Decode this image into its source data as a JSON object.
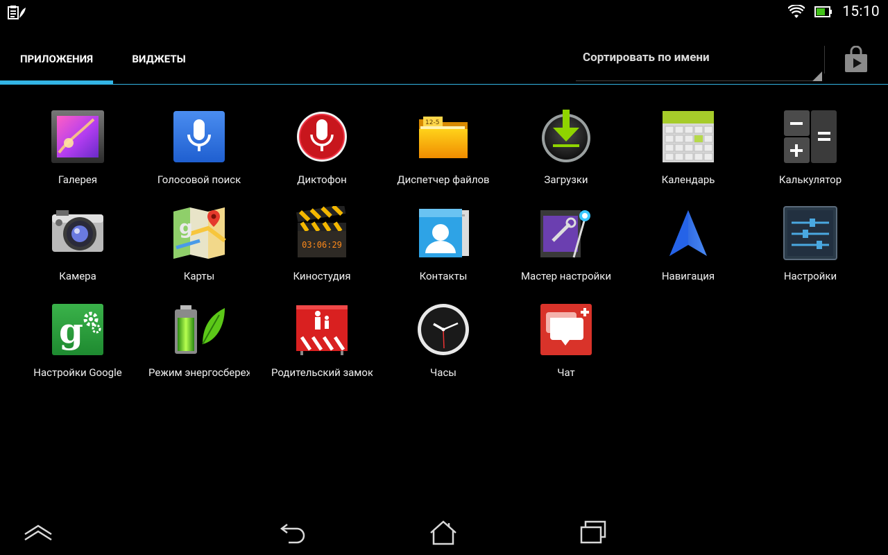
{
  "status_bar": {
    "time": "15:10",
    "left_icons": [
      "notification-clipboard-icon"
    ],
    "right_icons": [
      "wifi-icon",
      "battery-icon"
    ]
  },
  "tabs": [
    {
      "label": "ПРИЛОЖЕНИЯ",
      "selected": true
    },
    {
      "label": "ВИДЖЕТЫ",
      "selected": false
    }
  ],
  "sort": {
    "label": "Сортировать по имени"
  },
  "store_icon": "play-store-icon",
  "accent_color": "#33b5e5",
  "apps": [
    {
      "label": "Галерея",
      "icon": "gallery-icon"
    },
    {
      "label": "Голосовой поиск",
      "icon": "voice-search-icon"
    },
    {
      "label": "Диктофон",
      "icon": "dictaphone-icon"
    },
    {
      "label": "Диспетчер файлов",
      "icon": "file-manager-icon"
    },
    {
      "label": "Загрузки",
      "icon": "downloads-icon"
    },
    {
      "label": "Календарь",
      "icon": "calendar-icon"
    },
    {
      "label": "Калькулятор",
      "icon": "calculator-icon"
    },
    {
      "label": "Камера",
      "icon": "camera-icon"
    },
    {
      "label": "Карты",
      "icon": "maps-icon"
    },
    {
      "label": "Киностудия",
      "icon": "movie-studio-icon"
    },
    {
      "label": "Контакты",
      "icon": "contacts-icon"
    },
    {
      "label": "Мастер настройки",
      "icon": "setup-wizard-icon"
    },
    {
      "label": "Навигация",
      "icon": "navigation-icon"
    },
    {
      "label": "Настройки",
      "icon": "settings-icon"
    },
    {
      "label": "Настройки Google",
      "icon": "google-settings-icon"
    },
    {
      "label": "Режим энергосбережения",
      "icon": "power-saving-icon"
    },
    {
      "label": "Родительский замок",
      "icon": "parental-lock-icon"
    },
    {
      "label": "Часы",
      "icon": "clock-icon"
    },
    {
      "label": "Чат",
      "icon": "chat-icon"
    }
  ],
  "clapper_text": "03:06:29",
  "folder_text": "12-5",
  "nav_buttons": [
    "home-up-icon",
    "back-icon",
    "home-icon",
    "recent-apps-icon"
  ]
}
